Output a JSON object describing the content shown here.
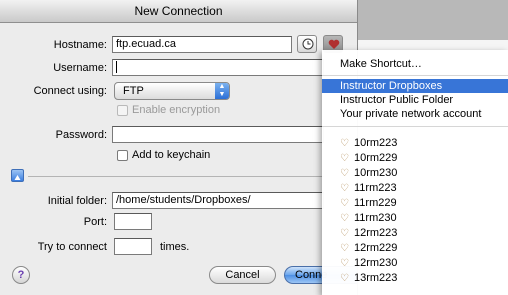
{
  "window": {
    "title": "New Connection"
  },
  "form": {
    "hostname_label": "Hostname:",
    "hostname_value": "ftp.ecuad.ca",
    "username_label": "Username:",
    "username_value": "",
    "connect_using_label": "Connect using:",
    "connect_using_value": "FTP",
    "enable_encryption_label": "Enable encryption",
    "password_label": "Password:",
    "password_value": "",
    "add_keychain_label": "Add to keychain",
    "initial_folder_label": "Initial folder:",
    "initial_folder_value": "/home/students/Dropboxes/",
    "port_label": "Port:",
    "port_value": "",
    "try_connect_label": "Try to connect",
    "try_connect_value": "",
    "times_label": "times."
  },
  "buttons": {
    "help": "?",
    "cancel": "Cancel",
    "connect": "Conne"
  },
  "menu": {
    "top_item": "Make Shortcut…",
    "group1": [
      "Instructor Dropboxes",
      "Instructor Public Folder",
      "Your private network account"
    ],
    "selected_index": 0,
    "hosts": [
      "10rm223",
      "10rm229",
      "10rm230",
      "11rm223",
      "11rm229",
      "11rm230",
      "12rm223",
      "12rm229",
      "12rm230",
      "13rm223"
    ]
  }
}
